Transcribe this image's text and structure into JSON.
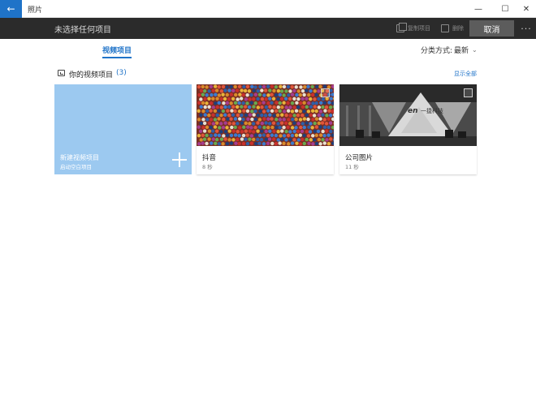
{
  "window": {
    "app_title": "照片",
    "back_icon": "back-arrow-icon",
    "controls": {
      "minimize": "—",
      "maximize": "☐",
      "close": "✕"
    }
  },
  "command_bar": {
    "selection_status": "未选择任何项目",
    "copy_label": "复制项目",
    "delete_label": "删除",
    "cancel_label": "取消",
    "more_label": "···"
  },
  "tabs": {
    "active": "视频项目"
  },
  "sort": {
    "label": "分类方式:",
    "value": "最新"
  },
  "section": {
    "title": "你的视频项目",
    "count": "(3)",
    "show_all": "显示全部"
  },
  "cards": {
    "new_project": {
      "title": "新建视频项目",
      "subtitle": "启动空白项目"
    },
    "douyin": {
      "title": "抖音",
      "duration": "8 秒"
    },
    "company": {
      "title": "公司图片",
      "duration": "11 秒",
      "logo_text": "一捷科技"
    }
  },
  "colors": {
    "accent": "#1f73c8",
    "command_bar": "#2b2b2b",
    "new_card": "#9cc9f0",
    "cancel_button": "#5c5c5c"
  }
}
